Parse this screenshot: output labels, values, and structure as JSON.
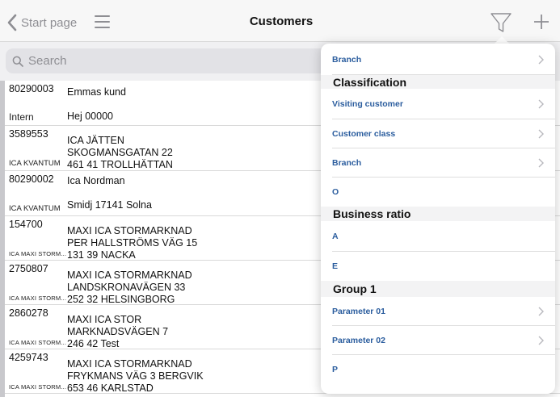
{
  "navbar": {
    "back_label": "Start page",
    "title": "Customers",
    "back_icon": "chevron-left-icon",
    "menu_icon": "hamburger-menu-icon",
    "filter_icon": "funnel-icon",
    "add_icon": "plus-icon"
  },
  "search": {
    "placeholder": "Search",
    "icon": "magnifier-icon"
  },
  "customers": [
    {
      "number": "80290003",
      "tag": "Intern",
      "lines": [
        "Emmas kund",
        "",
        "Hej 00000"
      ]
    },
    {
      "number": "3589553",
      "tag": "ICA KVANTUM",
      "lines": [
        "ICA JÄTTEN",
        "SKOGMANSGATAN 22",
        "461 41 TROLLHÄTTAN"
      ]
    },
    {
      "number": "80290002",
      "tag": "ICA KVANTUM",
      "lines": [
        "Ica Nordman",
        "",
        "Smidj 17141 Solna"
      ]
    },
    {
      "number": "154700",
      "tag": "ICA MAXI STORM...",
      "lines": [
        "MAXI ICA STORMARKNAD",
        "PER HALLSTRÖMS VÄG 15",
        "131 39 NACKA"
      ]
    },
    {
      "number": "2750807",
      "tag": "ICA MAXI STORM...",
      "lines": [
        "MAXI ICA STORMARKNAD",
        "LANDSKRONAVÄGEN 33",
        "252 32 HELSINGBORG"
      ]
    },
    {
      "number": "2860278",
      "tag": "ICA MAXI STORM...",
      "lines": [
        "MAXI ICA STOR",
        "MARKNADSVÄGEN 7",
        "246 42 Test"
      ]
    },
    {
      "number": "4259743",
      "tag": "ICA MAXI STORM...",
      "lines": [
        "MAXI ICA STORMARKNAD",
        "FRYKMANS VÄG 3 BERGVIK",
        "653 46 KARLSTAD"
      ]
    }
  ],
  "filter_popover": {
    "items": [
      {
        "kind": "row",
        "label": "Branch",
        "chevron": true
      },
      {
        "kind": "section",
        "label": "Classification"
      },
      {
        "kind": "row",
        "label": "Visiting customer",
        "chevron": true
      },
      {
        "kind": "row",
        "label": "Customer class",
        "chevron": true
      },
      {
        "kind": "row",
        "label": "Branch",
        "chevron": true
      },
      {
        "kind": "row",
        "label": "O",
        "chevron": false
      },
      {
        "kind": "section",
        "label": "Business ratio"
      },
      {
        "kind": "row",
        "label": "A",
        "chevron": false
      },
      {
        "kind": "row",
        "label": "E",
        "chevron": false
      },
      {
        "kind": "section",
        "label": "Group 1"
      },
      {
        "kind": "row",
        "label": "Parameter 01",
        "chevron": true
      },
      {
        "kind": "row",
        "label": "Parameter 02",
        "chevron": true
      },
      {
        "kind": "row",
        "label": "P",
        "chevron": false
      }
    ]
  },
  "colors": {
    "accent_link": "#2b5d9e",
    "nav_gray": "#8e8e93"
  }
}
